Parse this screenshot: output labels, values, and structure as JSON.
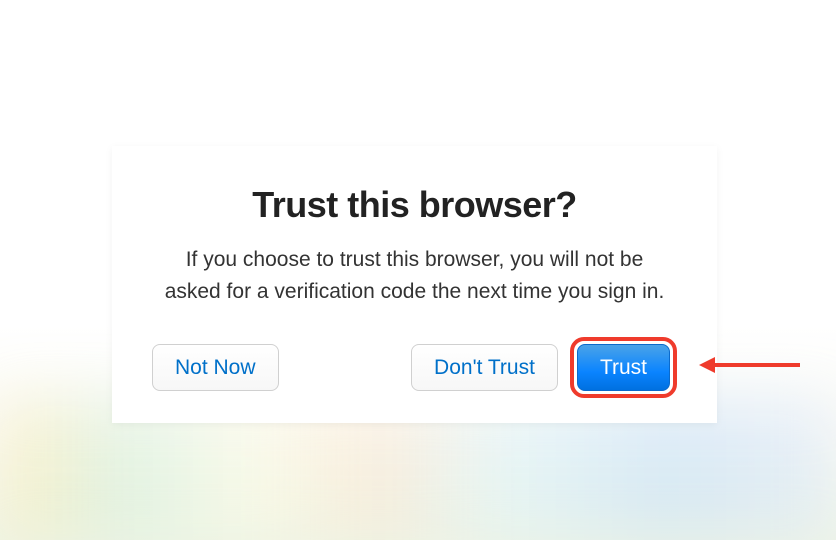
{
  "dialog": {
    "title": "Trust this browser?",
    "body": "If you choose to trust this browser, you will not be asked for a verification code the next time you sign in.",
    "buttons": {
      "not_now": "Not Now",
      "dont_trust": "Don't Trust",
      "trust": "Trust"
    }
  },
  "annotation": {
    "highlight_color": "#ef3b2c"
  }
}
